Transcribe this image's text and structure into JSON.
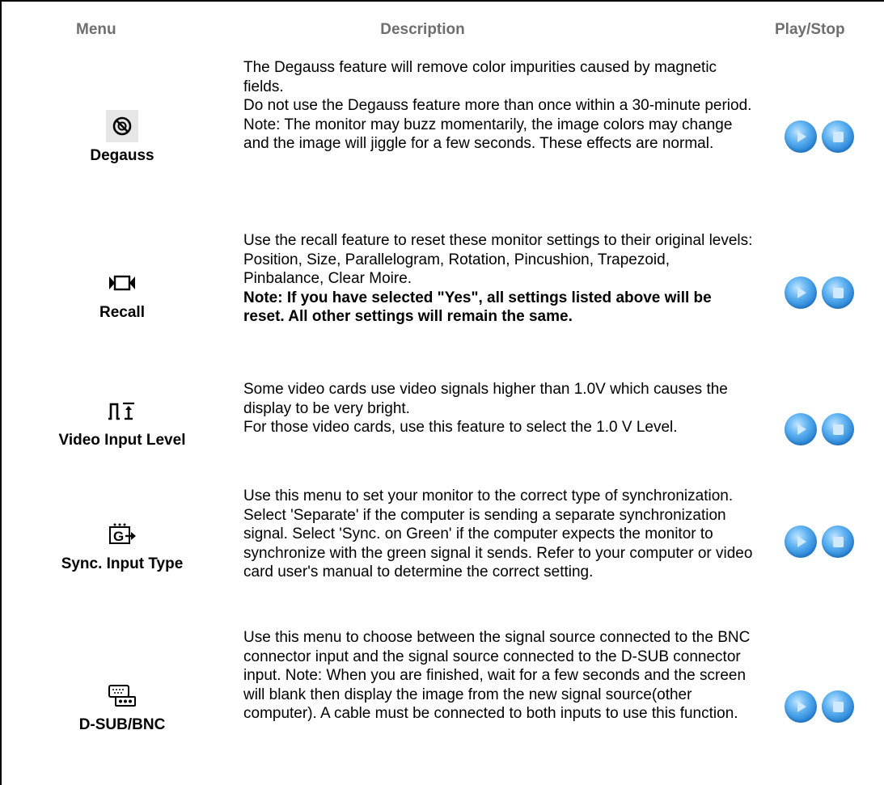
{
  "header": {
    "menu": "Menu",
    "description": "Description",
    "play_stop": "Play/Stop"
  },
  "rows": [
    {
      "label": "Degauss",
      "icon": "degauss-icon",
      "paragraphs": [
        "The Degauss feature will remove color impurities caused by magnetic fields.",
        "Do not use the Degauss feature more than once within a 30-minute period.",
        "Note: The monitor may buzz momentarily, the image colors may change and the image will jiggle for a few seconds. These effects are normal."
      ]
    },
    {
      "label": "Recall",
      "icon": "recall-icon",
      "paragraphs": [
        "Use the recall feature to reset these monitor settings to their original levels: Position, Size, Parallelogram, Rotation, Pincushion, Trapezoid, Pinbalance, Clear Moire."
      ],
      "bold_note": "Note: If you have selected \"Yes\", all settings listed above will be reset. All other settings will remain the same."
    },
    {
      "label": "Video Input Level",
      "icon": "video-input-level-icon",
      "paragraphs": [
        "Some video cards use video signals higher than 1.0V which causes the display to be very bright.",
        "For those video cards, use this feature to select the 1.0 V Level."
      ]
    },
    {
      "label": "Sync. Input Type",
      "icon": "sync-input-type-icon",
      "paragraphs": [
        "Use this menu to set your monitor to the correct type of synchronization. Select 'Separate' if the computer is sending a separate synchronization signal. Select 'Sync. on Green' if the computer expects the monitor to synchronize with the green signal it sends. Refer to your computer or video card user's manual to determine the correct setting."
      ]
    },
    {
      "label": "D-SUB/BNC",
      "icon": "dsub-bnc-icon",
      "paragraphs": [
        "Use this menu to choose between the signal source connected to the BNC connector input and the signal source connected to the D-SUB connector input. Note: When you are finished, wait for a few seconds and the screen will blank then display the image from the new signal source(other computer). A cable must be connected to both inputs to use this function."
      ]
    }
  ]
}
